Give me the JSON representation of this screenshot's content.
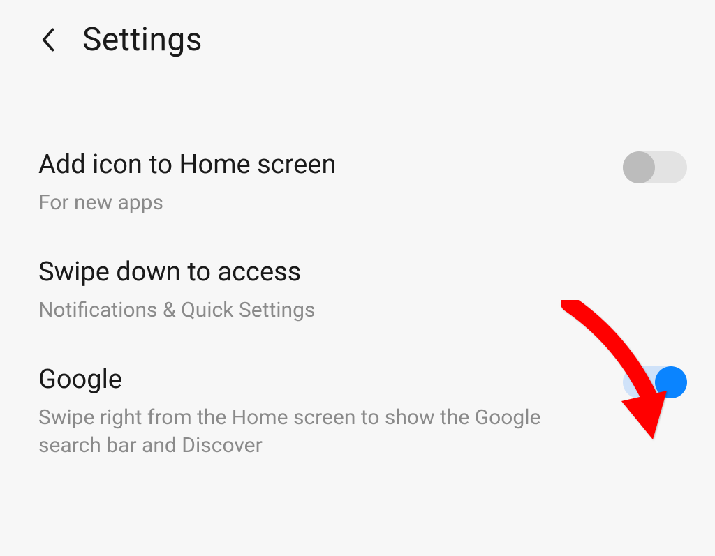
{
  "header": {
    "title": "Settings"
  },
  "items": [
    {
      "title": "Add icon to Home screen",
      "subtitle": "For new apps",
      "toggle": "off"
    },
    {
      "title": "Swipe down to access",
      "subtitle": "Notifications & Quick Settings",
      "toggle": null
    },
    {
      "title": "Google",
      "subtitle": "Swipe right from the Home screen to show the Google search bar and Discover",
      "toggle": "on"
    }
  ],
  "annotation": {
    "type": "arrow",
    "target": "google-toggle",
    "color": "#ff0000"
  }
}
